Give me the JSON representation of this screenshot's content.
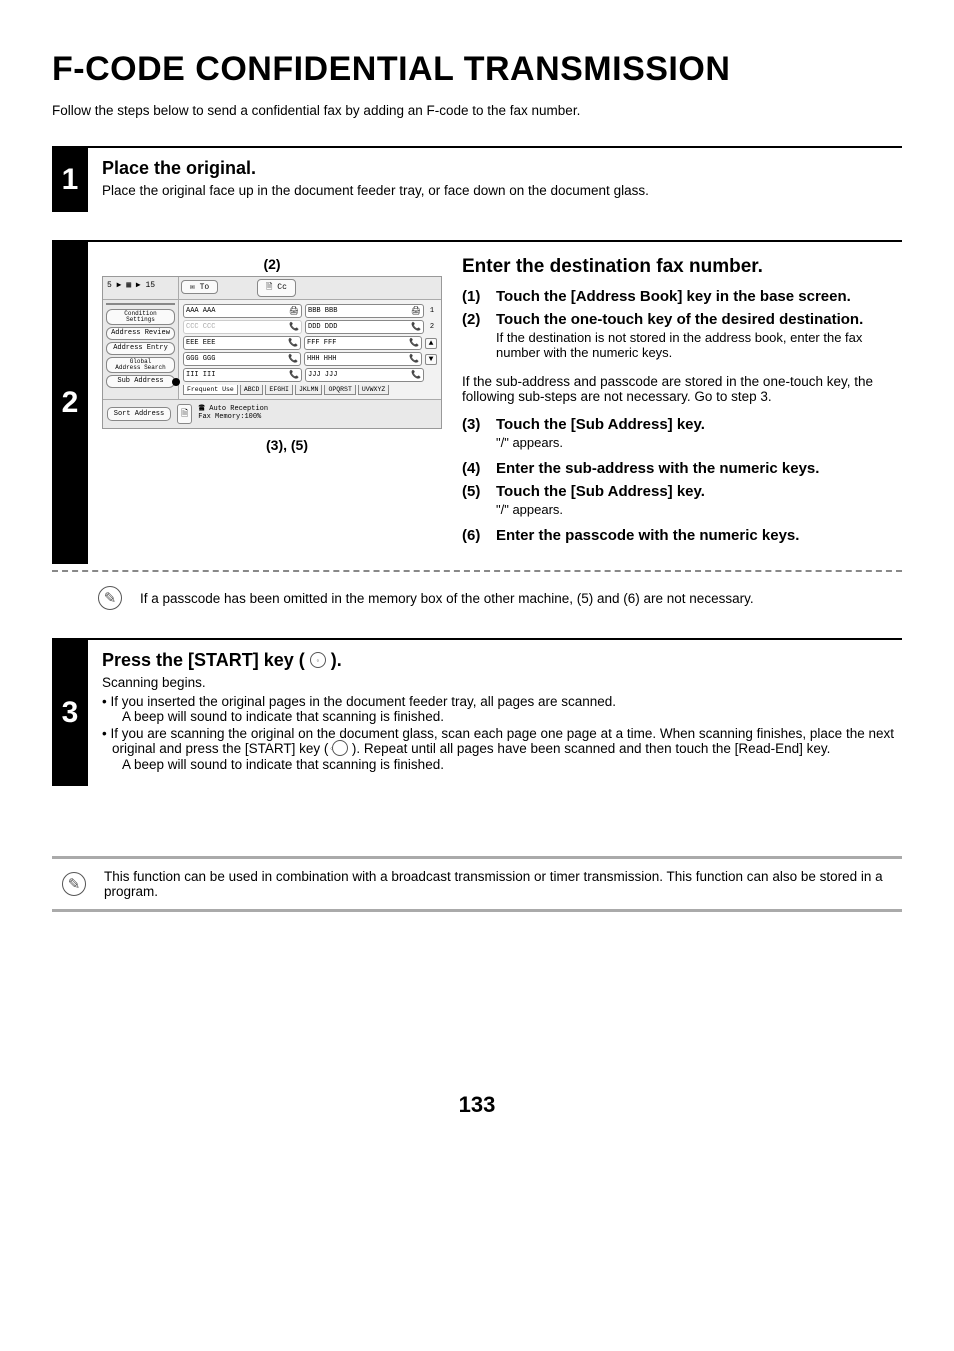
{
  "title": "F-CODE CONFIDENTIAL TRANSMISSION",
  "intro": "Follow the steps below to send a confidential fax by adding an F-code to the fax number.",
  "step1": {
    "num": "1",
    "heading": "Place the original.",
    "body": "Place the original face up in the document feeder tray, or face down on the document glass."
  },
  "step2": {
    "num": "2",
    "callout_top": "(2)",
    "callout_bottom": "(3), (5)",
    "heading": "Enter the destination fax number.",
    "screen": {
      "head_left": "5 ▶ ▦ ▶ 15",
      "tab_to": "✉ To",
      "tab_cc": "🗎 Cc",
      "side": {
        "cond": "Condition\nSettings",
        "review": "Address Review",
        "entry": "Address Entry",
        "global": "Global\nAddress Search",
        "sub": "Sub Address"
      },
      "entries": [
        [
          "AAA AAA",
          "BBB BBB",
          "1"
        ],
        [
          "CCC CCC",
          "DDD DDD",
          "2"
        ],
        [
          "EEE EEE",
          "FFF FFF",
          ""
        ],
        [
          "GGG GGG",
          "HHH HHH",
          ""
        ],
        [
          "III III",
          "JJJ JJJ",
          ""
        ]
      ],
      "tabs": [
        "Frequent Use",
        "ABCD",
        "EFGHI",
        "JKLMN",
        "OPQRST",
        "UVWXYZ"
      ],
      "foot_btn": "Sort Address",
      "foot_txt1": "🖀 Auto Reception",
      "foot_txt2": "Fax Memory:100%"
    },
    "s1": {
      "n": "(1)",
      "b": "Touch the [Address Book] key in the base screen."
    },
    "s2": {
      "n": "(2)",
      "b": "Touch the one-touch key of the desired destination.",
      "note": "If the destination is not stored in the address book, enter the fax number with the numeric keys."
    },
    "mid_note": "If the sub-address and passcode are stored in the one-touch key, the following sub-steps are not necessary. Go to step 3.",
    "s3": {
      "n": "(3)",
      "b": "Touch the [Sub Address] key.",
      "note": "\"/\" appears."
    },
    "s4": {
      "n": "(4)",
      "b": "Enter the sub-address with the numeric keys."
    },
    "s5": {
      "n": "(5)",
      "b": "Touch the [Sub Address] key.",
      "note": "\"/\" appears."
    },
    "s6": {
      "n": "(6)",
      "b": "Enter the passcode with the numeric keys."
    },
    "note_text": "If a passcode has been omitted in the memory box of the other machine, (5) and (6) are not necessary."
  },
  "step3": {
    "num": "3",
    "heading_a": "Press the [START] key ( ",
    "heading_b": " ).",
    "line1": "Scanning begins.",
    "b1a": "• If you inserted the original pages in the document feeder tray, all pages are scanned.",
    "b1b": "A beep will sound to indicate that scanning is finished.",
    "b2a": "• If you are scanning the original on the document glass, scan each page one page at a time. When scanning finishes, place the next original and press the [START] key ( ",
    "b2b": " ). Repeat until all pages have been scanned and then touch the [Read-End] key.",
    "b2c": "A beep will sound to indicate that scanning is finished."
  },
  "bottom_note": "This function can be used in combination with a broadcast transmission or timer transmission. This function can also be stored in a program.",
  "page_num": "133"
}
